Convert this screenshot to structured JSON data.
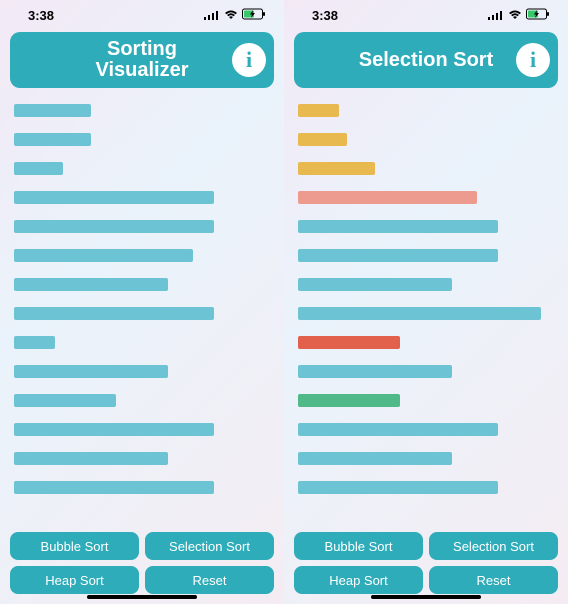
{
  "status": {
    "time": "3:38"
  },
  "colors": {
    "accent": "#2eacb9",
    "bar_default": "#6cc3d4",
    "bar_sorted": "#e8b94e",
    "bar_compare": "#ed9b8f",
    "bar_active": "#e2614d",
    "bar_min": "#4fb987"
  },
  "screens": [
    {
      "title": "Sorting\nVisualizer",
      "bars": [
        {
          "pct": 30,
          "color": "teal"
        },
        {
          "pct": 30,
          "color": "teal"
        },
        {
          "pct": 19,
          "color": "teal"
        },
        {
          "pct": 78,
          "color": "teal"
        },
        {
          "pct": 78,
          "color": "teal"
        },
        {
          "pct": 70,
          "color": "teal"
        },
        {
          "pct": 60,
          "color": "teal"
        },
        {
          "pct": 78,
          "color": "teal"
        },
        {
          "pct": 16,
          "color": "teal"
        },
        {
          "pct": 60,
          "color": "teal"
        },
        {
          "pct": 40,
          "color": "teal"
        },
        {
          "pct": 78,
          "color": "teal"
        },
        {
          "pct": 60,
          "color": "teal"
        },
        {
          "pct": 78,
          "color": "teal"
        }
      ],
      "buttons": [
        "Bubble Sort",
        "Selection Sort",
        "Heap Sort",
        "Reset"
      ]
    },
    {
      "title": "Selection Sort",
      "bars": [
        {
          "pct": 16,
          "color": "yellow"
        },
        {
          "pct": 19,
          "color": "yellow"
        },
        {
          "pct": 30,
          "color": "yellow"
        },
        {
          "pct": 70,
          "color": "salmon"
        },
        {
          "pct": 78,
          "color": "teal"
        },
        {
          "pct": 78,
          "color": "teal"
        },
        {
          "pct": 60,
          "color": "teal"
        },
        {
          "pct": 95,
          "color": "teal"
        },
        {
          "pct": 40,
          "color": "red"
        },
        {
          "pct": 60,
          "color": "teal"
        },
        {
          "pct": 40,
          "color": "green"
        },
        {
          "pct": 78,
          "color": "teal"
        },
        {
          "pct": 60,
          "color": "teal"
        },
        {
          "pct": 78,
          "color": "teal"
        }
      ],
      "buttons": [
        "Bubble Sort",
        "Selection Sort",
        "Heap Sort",
        "Reset"
      ]
    }
  ],
  "info_glyph": "i"
}
